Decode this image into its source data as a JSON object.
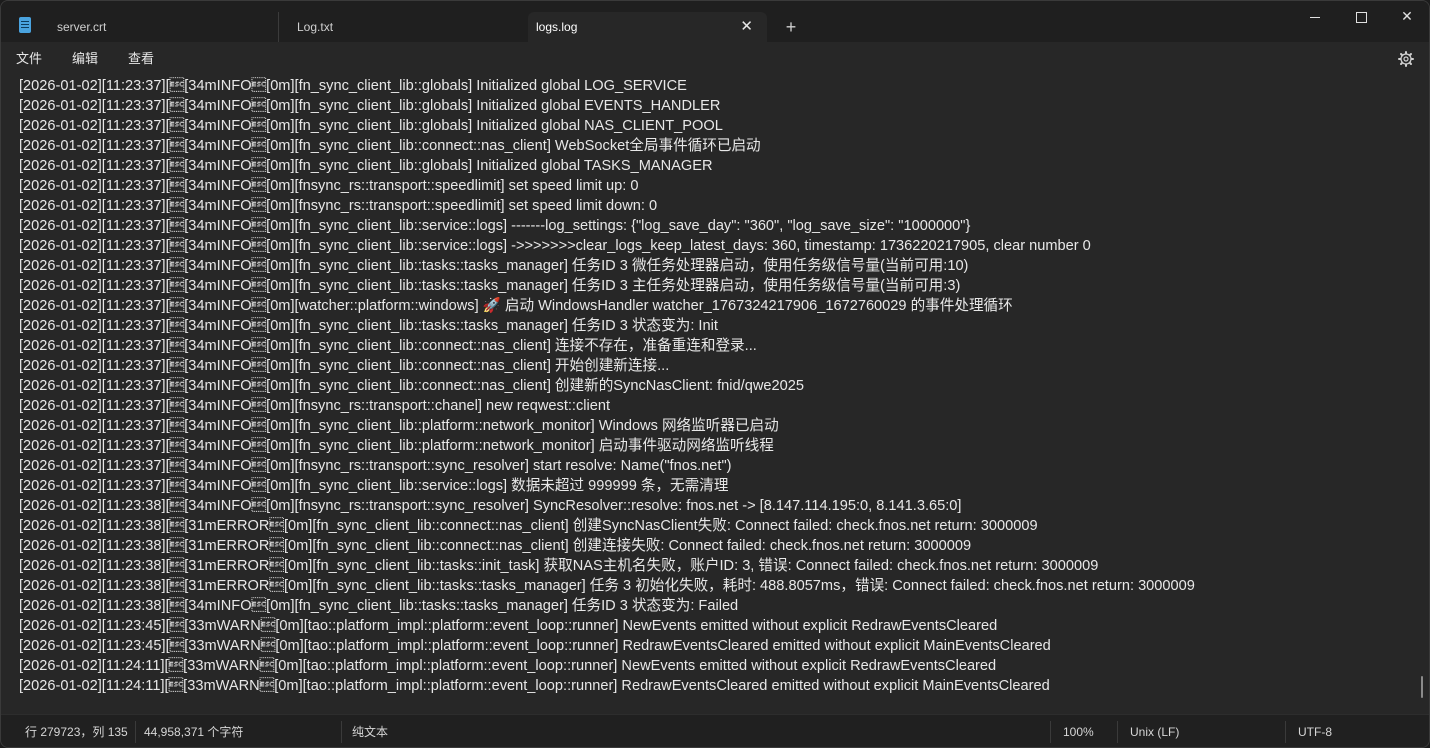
{
  "tabs": [
    {
      "label": "server.crt"
    },
    {
      "label": "Log.txt"
    },
    {
      "label": "logs.log",
      "active": true
    }
  ],
  "tab_close_glyph": "✕",
  "new_tab_glyph": "+",
  "window_close_glyph": "✕",
  "menu": [
    "文件",
    "编辑",
    "查看"
  ],
  "log_lines": [
    "[2026-01-02][11:23:37][\u001b[34mINFO\u001b[0m][fn_sync_client_lib::globals] Initialized global LOG_SERVICE",
    "[2026-01-02][11:23:37][\u001b[34mINFO\u001b[0m][fn_sync_client_lib::globals] Initialized global EVENTS_HANDLER",
    "[2026-01-02][11:23:37][\u001b[34mINFO\u001b[0m][fn_sync_client_lib::globals] Initialized global NAS_CLIENT_POOL",
    "[2026-01-02][11:23:37][\u001b[34mINFO\u001b[0m][fn_sync_client_lib::connect::nas_client] WebSocket全局事件循环已启动",
    "[2026-01-02][11:23:37][\u001b[34mINFO\u001b[0m][fn_sync_client_lib::globals] Initialized global TASKS_MANAGER",
    "[2026-01-02][11:23:37][\u001b[34mINFO\u001b[0m][fnsync_rs::transport::speedlimit] set speed limit up: 0",
    "[2026-01-02][11:23:37][\u001b[34mINFO\u001b[0m][fnsync_rs::transport::speedlimit] set speed limit down: 0",
    "[2026-01-02][11:23:37][\u001b[34mINFO\u001b[0m][fn_sync_client_lib::service::logs] -------log_settings: {\"log_save_day\": \"360\", \"log_save_size\": \"1000000\"}",
    "[2026-01-02][11:23:37][\u001b[34mINFO\u001b[0m][fn_sync_client_lib::service::logs] ->>>>>>>clear_logs_keep_latest_days: 360, timestamp: 1736220217905, clear number 0",
    "[2026-01-02][11:23:37][\u001b[34mINFO\u001b[0m][fn_sync_client_lib::tasks::tasks_manager] 任务ID 3 微任务处理器启动，使用任务级信号量(当前可用:10)",
    "[2026-01-02][11:23:37][\u001b[34mINFO\u001b[0m][fn_sync_client_lib::tasks::tasks_manager] 任务ID 3 主任务处理器启动，使用任务级信号量(当前可用:3)",
    "[2026-01-02][11:23:37][\u001b[34mINFO\u001b[0m][watcher::platform::windows] 🚀 启动 WindowsHandler watcher_1767324217906_1672760029 的事件处理循环",
    "[2026-01-02][11:23:37][\u001b[34mINFO\u001b[0m][fn_sync_client_lib::tasks::tasks_manager] 任务ID 3 状态变为: Init",
    "[2026-01-02][11:23:37][\u001b[34mINFO\u001b[0m][fn_sync_client_lib::connect::nas_client] 连接不存在，准备重连和登录...",
    "[2026-01-02][11:23:37][\u001b[34mINFO\u001b[0m][fn_sync_client_lib::connect::nas_client] 开始创建新连接...",
    "[2026-01-02][11:23:37][\u001b[34mINFO\u001b[0m][fn_sync_client_lib::connect::nas_client] 创建新的SyncNasClient: fnid/qwe2025",
    "[2026-01-02][11:23:37][\u001b[34mINFO\u001b[0m][fnsync_rs::transport::chanel] new reqwest::client",
    "[2026-01-02][11:23:37][\u001b[34mINFO\u001b[0m][fn_sync_client_lib::platform::network_monitor] Windows 网络监听器已启动",
    "[2026-01-02][11:23:37][\u001b[34mINFO\u001b[0m][fn_sync_client_lib::platform::network_monitor] 启动事件驱动网络监听线程",
    "[2026-01-02][11:23:37][\u001b[34mINFO\u001b[0m][fnsync_rs::transport::sync_resolver] start resolve: Name(\"fnos.net\")",
    "[2026-01-02][11:23:37][\u001b[34mINFO\u001b[0m][fn_sync_client_lib::service::logs] 数据未超过 999999 条，无需清理",
    "[2026-01-02][11:23:38][\u001b[34mINFO\u001b[0m][fnsync_rs::transport::sync_resolver] SyncResolver::resolve: fnos.net -> [8.147.114.195:0, 8.141.3.65:0]",
    "[2026-01-02][11:23:38][\u001b[31mERROR\u001b[0m][fn_sync_client_lib::connect::nas_client] 创建SyncNasClient失败: Connect failed: check.fnos.net return: 3000009",
    "[2026-01-02][11:23:38][\u001b[31mERROR\u001b[0m][fn_sync_client_lib::connect::nas_client] 创建连接失败: Connect failed: check.fnos.net return: 3000009",
    "[2026-01-02][11:23:38][\u001b[31mERROR\u001b[0m][fn_sync_client_lib::tasks::init_task] 获取NAS主机名失败，账户ID: 3, 错误: Connect failed: check.fnos.net return: 3000009",
    "[2026-01-02][11:23:38][\u001b[31mERROR\u001b[0m][fn_sync_client_lib::tasks::tasks_manager] 任务 3 初始化失败，耗时: 488.8057ms，错误: Connect failed: check.fnos.net return: 3000009",
    "[2026-01-02][11:23:38][\u001b[34mINFO\u001b[0m][fn_sync_client_lib::tasks::tasks_manager] 任务ID 3 状态变为: Failed",
    "[2026-01-02][11:23:45][\u001b[33mWARN\u001b[0m][tao::platform_impl::platform::event_loop::runner] NewEvents emitted without explicit RedrawEventsCleared",
    "[2026-01-02][11:23:45][\u001b[33mWARN\u001b[0m][tao::platform_impl::platform::event_loop::runner] RedrawEventsCleared emitted without explicit MainEventsCleared",
    "[2026-01-02][11:24:11][\u001b[33mWARN\u001b[0m][tao::platform_impl::platform::event_loop::runner] NewEvents emitted without explicit RedrawEventsCleared",
    "[2026-01-02][11:24:11][\u001b[33mWARN\u001b[0m][tao::platform_impl::platform::event_loop::runner] RedrawEventsCleared emitted without explicit MainEventsCleared"
  ],
  "status": {
    "position": "行 279723，列 135",
    "char_count": "44,958,371 个字符",
    "format": "纯文本",
    "zoom": "100%",
    "line_ending": "Unix (LF)",
    "encoding": "UTF-8"
  },
  "icons": {
    "app": "notepad-icon",
    "settings": "gear-icon"
  },
  "colors": {
    "background": "#272727",
    "titlebar": "#1f1f1f",
    "statusbar": "#202020",
    "text": "#e8e8e8"
  }
}
